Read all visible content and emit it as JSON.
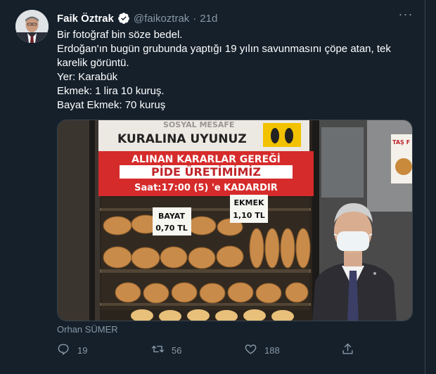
{
  "tweet": {
    "author_name": "Faik Öztrak",
    "handle": "@faikoztrak",
    "separator": "·",
    "time": "21d",
    "more_label": "···",
    "lines": [
      "Bir fotoğraf bin söze bedel.",
      "Erdoğan'ın bugün grubunda yaptığı 19 yılın savunmasını çöpe atan, tek",
      "karelik görüntü.",
      "Yer: Karabük",
      "Ekmek: 1 lira 10 kuruş.",
      "Bayat Ekmek: 70 kuruş"
    ],
    "photo": {
      "sign_top": "KURALINA UYUNUZ",
      "sign_top_faded": "SOSYAL MESAFE",
      "sign_main_1": "ALINAN KARARLAR GEREĞİ",
      "sign_main_2": "PİDE ÜRETİMİMİZ",
      "sign_main_3": "Saat:17:00 (5) 'e KADARDIR",
      "tag_left_1": "BAYAT",
      "tag_left_2": "0,70 TL",
      "tag_right_1": "EKMEK",
      "tag_right_2": "1,10 TL",
      "right_poster": "TAŞ F"
    },
    "photo_credit": "Orhan SÜMER",
    "actions": {
      "reply_count": "19",
      "retweet_count": "56",
      "like_count": "188"
    }
  },
  "colors": {
    "background": "#15202b",
    "secondary_text": "#8899a6",
    "verified": "#1da1f2",
    "sign_red": "#d62b2b"
  },
  "icons": [
    "verified-badge-icon",
    "reply-icon",
    "retweet-icon",
    "like-icon",
    "share-icon"
  ]
}
